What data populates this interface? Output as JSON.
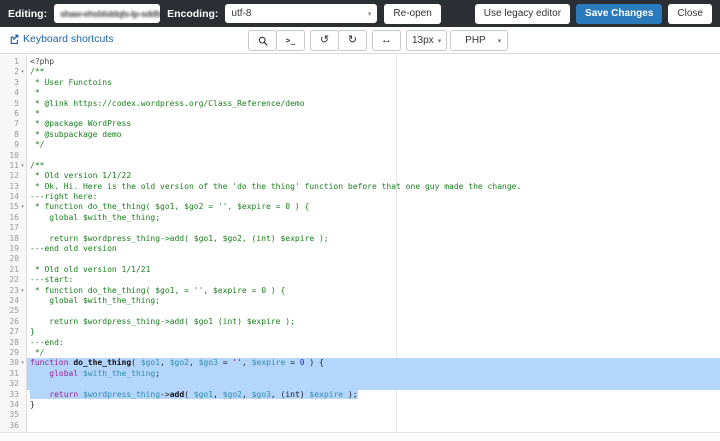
{
  "topbar": {
    "editing_label": "Editing:",
    "editing_value_blurred": "shaw-ehsblsldqls-lp-sddls_b",
    "encoding_label": "Encoding:",
    "encoding_value": "utf-8",
    "reopen_button": "Re-open",
    "legacy_button": "Use legacy editor",
    "save_button": "Save Changes",
    "close_button": "Close"
  },
  "toolbar": {
    "keyboard_shortcuts_link": "Keyboard shortcuts",
    "console_glyph": ">_",
    "undo_glyph": "↺",
    "redo_glyph": "↻",
    "fullwidth_glyph": "↔",
    "font_size_value": "13px",
    "mode_value": "PHP"
  },
  "editor": {
    "selection_color": "#b4d5fc",
    "syntax_colors": {
      "comment": "#19801d",
      "keyword": "#9b2393",
      "variable": "#2e8fad",
      "number": "#2233cc",
      "string": "#a11616"
    },
    "lines": [
      {
        "n": 1,
        "fold": false,
        "sel": null,
        "tokens": [
          {
            "c": "meta",
            "t": "<?php"
          }
        ]
      },
      {
        "n": 2,
        "fold": true,
        "sel": null,
        "tokens": [
          {
            "c": "cm",
            "t": "/**"
          }
        ]
      },
      {
        "n": 3,
        "fold": false,
        "sel": null,
        "tokens": [
          {
            "c": "cm",
            "t": " * User Functoins"
          }
        ]
      },
      {
        "n": 4,
        "fold": false,
        "sel": null,
        "tokens": [
          {
            "c": "cm",
            "t": " *"
          }
        ]
      },
      {
        "n": 5,
        "fold": false,
        "sel": null,
        "tokens": [
          {
            "c": "cm",
            "t": " * @link https://codex.wordpress.org/Class_Reference/demo"
          }
        ]
      },
      {
        "n": 6,
        "fold": false,
        "sel": null,
        "tokens": [
          {
            "c": "cm",
            "t": " *"
          }
        ]
      },
      {
        "n": 7,
        "fold": false,
        "sel": null,
        "tokens": [
          {
            "c": "cm",
            "t": " * @package WordPress"
          }
        ]
      },
      {
        "n": 8,
        "fold": false,
        "sel": null,
        "tokens": [
          {
            "c": "cm",
            "t": " * @subpackage demo"
          }
        ]
      },
      {
        "n": 9,
        "fold": false,
        "sel": null,
        "tokens": [
          {
            "c": "cm",
            "t": " */"
          }
        ]
      },
      {
        "n": 10,
        "fold": false,
        "sel": null,
        "tokens": []
      },
      {
        "n": 11,
        "fold": true,
        "sel": null,
        "tokens": [
          {
            "c": "cm",
            "t": "/**"
          }
        ]
      },
      {
        "n": 12,
        "fold": false,
        "sel": null,
        "tokens": [
          {
            "c": "cm",
            "t": " * Old version 1/1/22"
          }
        ]
      },
      {
        "n": 13,
        "fold": false,
        "sel": null,
        "tokens": [
          {
            "c": "cm",
            "t": " * Ok. Hi. Here is the old version of the 'do the thing' function before that one guy made the change."
          }
        ]
      },
      {
        "n": 14,
        "fold": false,
        "sel": null,
        "tokens": [
          {
            "c": "cm",
            "t": "---right here:"
          }
        ]
      },
      {
        "n": 15,
        "fold": true,
        "sel": null,
        "tokens": [
          {
            "c": "cm",
            "t": " * function do_the_thing( $go1, $go2 = '', $expire = 0 ) {"
          }
        ]
      },
      {
        "n": 16,
        "fold": false,
        "sel": null,
        "tokens": [
          {
            "c": "cm",
            "t": "    global $with_the_thing;"
          }
        ]
      },
      {
        "n": 17,
        "fold": false,
        "sel": null,
        "tokens": []
      },
      {
        "n": 18,
        "fold": false,
        "sel": null,
        "tokens": [
          {
            "c": "cm",
            "t": "    return $wordpress_thing->add( $go1, $go2, (int) $expire );"
          }
        ]
      },
      {
        "n": 19,
        "fold": false,
        "sel": null,
        "tokens": [
          {
            "c": "cm",
            "t": "---end old version"
          }
        ]
      },
      {
        "n": 20,
        "fold": false,
        "sel": null,
        "tokens": []
      },
      {
        "n": 21,
        "fold": false,
        "sel": null,
        "tokens": [
          {
            "c": "cm",
            "t": " * Old old version 1/1/21"
          }
        ]
      },
      {
        "n": 22,
        "fold": false,
        "sel": null,
        "tokens": [
          {
            "c": "cm",
            "t": "---start:"
          }
        ]
      },
      {
        "n": 23,
        "fold": true,
        "sel": null,
        "tokens": [
          {
            "c": "cm",
            "t": " * function do_the_thing( $go1, = '', $expire = 0 ) {"
          }
        ]
      },
      {
        "n": 24,
        "fold": false,
        "sel": null,
        "tokens": [
          {
            "c": "cm",
            "t": "    global $with_the_thing;"
          }
        ]
      },
      {
        "n": 25,
        "fold": false,
        "sel": null,
        "tokens": []
      },
      {
        "n": 26,
        "fold": false,
        "sel": null,
        "tokens": [
          {
            "c": "cm",
            "t": "    return $wordpress_thing->add( $go1 (int) $expire );"
          }
        ]
      },
      {
        "n": 27,
        "fold": false,
        "sel": null,
        "tokens": [
          {
            "c": "cm",
            "t": "}"
          }
        ]
      },
      {
        "n": 28,
        "fold": false,
        "sel": null,
        "tokens": [
          {
            "c": "cm",
            "t": "---end:"
          }
        ]
      },
      {
        "n": 29,
        "fold": false,
        "sel": null,
        "tokens": [
          {
            "c": "cm",
            "t": " */"
          }
        ]
      },
      {
        "n": 30,
        "fold": true,
        "sel": "full",
        "tokens": [
          {
            "c": "kw",
            "t": "function"
          },
          {
            "c": "def",
            "t": " do_the_thing"
          },
          {
            "c": "pl",
            "t": "( "
          },
          {
            "c": "var",
            "t": "$go1"
          },
          {
            "c": "pl",
            "t": ", "
          },
          {
            "c": "var",
            "t": "$go2"
          },
          {
            "c": "pl",
            "t": ", "
          },
          {
            "c": "var",
            "t": "$go3"
          },
          {
            "c": "pl",
            "t": " = "
          },
          {
            "c": "str",
            "t": "''"
          },
          {
            "c": "pl",
            "t": ", "
          },
          {
            "c": "var",
            "t": "$expire"
          },
          {
            "c": "pl",
            "t": " = "
          },
          {
            "c": "num",
            "t": "0"
          },
          {
            "c": "pl",
            "t": " ) {"
          }
        ]
      },
      {
        "n": 31,
        "fold": false,
        "sel": "full",
        "tokens": [
          {
            "c": "pl",
            "t": "    "
          },
          {
            "c": "kw",
            "t": "global"
          },
          {
            "c": "pl",
            "t": " "
          },
          {
            "c": "var",
            "t": "$with_the_thing"
          },
          {
            "c": "pl",
            "t": ";"
          }
        ]
      },
      {
        "n": 32,
        "fold": false,
        "sel": "full",
        "tokens": []
      },
      {
        "n": 33,
        "fold": false,
        "sel": "text",
        "tokens": [
          {
            "c": "pl",
            "t": "    "
          },
          {
            "c": "kw",
            "t": "return"
          },
          {
            "c": "pl",
            "t": " "
          },
          {
            "c": "var",
            "t": "$wordpress_thing"
          },
          {
            "c": "pl",
            "t": "->"
          },
          {
            "c": "def",
            "t": "add"
          },
          {
            "c": "pl",
            "t": "( "
          },
          {
            "c": "var",
            "t": "$go1"
          },
          {
            "c": "pl",
            "t": ", "
          },
          {
            "c": "var",
            "t": "$go2"
          },
          {
            "c": "pl",
            "t": ", "
          },
          {
            "c": "var",
            "t": "$go3"
          },
          {
            "c": "pl",
            "t": ", (int) "
          },
          {
            "c": "var",
            "t": "$expire"
          },
          {
            "c": "pl",
            "t": " );"
          }
        ]
      },
      {
        "n": 34,
        "fold": false,
        "sel": null,
        "tokens": [
          {
            "c": "pl",
            "t": "}"
          }
        ]
      },
      {
        "n": 35,
        "fold": false,
        "sel": null,
        "tokens": []
      },
      {
        "n": 36,
        "fold": false,
        "sel": null,
        "tokens": []
      }
    ]
  }
}
